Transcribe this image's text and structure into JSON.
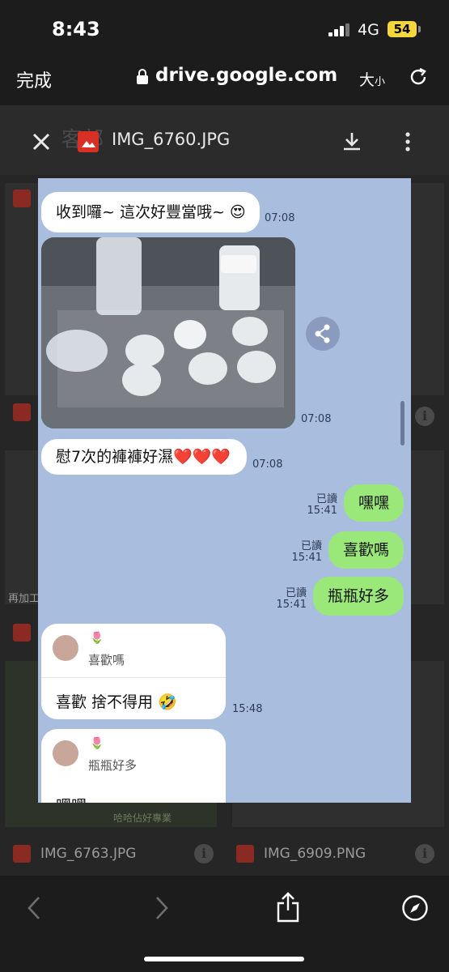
{
  "status_bar": {
    "time": "8:43",
    "network": "4G",
    "battery": "54"
  },
  "browser": {
    "done_label": "完成",
    "url": "drive.google.com",
    "text_size_label": "大",
    "text_size_small": "小"
  },
  "viewer": {
    "file_name": "IMG_6760.JPG",
    "ghost_title": "客部"
  },
  "grid": {
    "file_labels": [
      "IMG_6763.JPG",
      "IMG_6909.PNG"
    ],
    "snippet": "再加工",
    "snippet2": "哈哈佔好專業"
  },
  "chat": {
    "messages_left": [
      {
        "text": "收到囉~ 這次好豐當哦~ 😍",
        "time": "07:08"
      },
      {
        "text": "慰7次的褲褲好濕❤️❤️❤️",
        "time": "07:08"
      }
    ],
    "photo_time": "07:08",
    "messages_right": [
      {
        "text": "嘿嘿",
        "read": "已讀",
        "time": "15:41"
      },
      {
        "text": "喜歡嗎",
        "read": "已讀",
        "time": "15:41"
      },
      {
        "text": "瓶瓶好多",
        "read": "已讀",
        "time": "15:41"
      }
    ],
    "replies": [
      {
        "quote": "喜歡嗎",
        "text": "喜歡  捨不得用 🤣",
        "time": "15:48"
      },
      {
        "quote": "瓶瓶好多",
        "text": "嘿嘿"
      }
    ]
  },
  "colors": {
    "chat_bg": "#a9bedf",
    "my_bubble": "#9be87a",
    "battery": "#f5d63d"
  },
  "icons": [
    "lock-icon",
    "reload-icon",
    "close-icon",
    "download-icon",
    "more-icon",
    "share-icon",
    "back-icon",
    "forward-icon",
    "compass-icon"
  ]
}
